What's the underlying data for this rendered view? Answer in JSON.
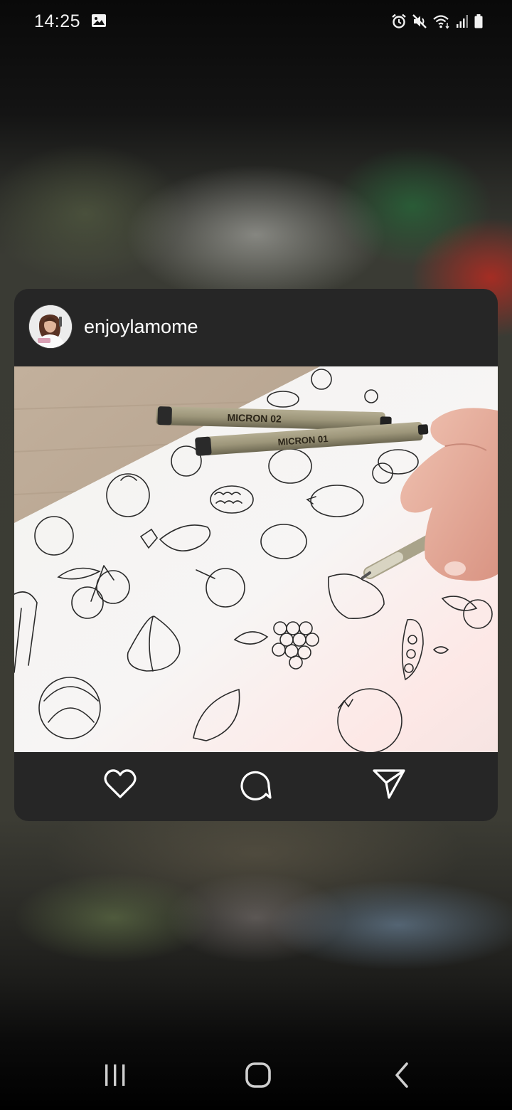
{
  "status_bar": {
    "time": "14:25",
    "left_icons": [
      "gallery-icon"
    ],
    "right_icons": [
      "alarm-icon",
      "mute-icon",
      "wifi-icon",
      "signal-icon",
      "battery-icon"
    ]
  },
  "post": {
    "username": "enjoylamome",
    "avatar_icon": "profile-avatar",
    "image_icon": "fruit-drawings-photo",
    "actions": {
      "like_icon": "heart-icon",
      "comment_icon": "comment-icon",
      "share_icon": "send-icon"
    }
  },
  "navigation_bar": {
    "icons": [
      "recent-apps-icon",
      "home-icon",
      "back-icon"
    ]
  },
  "colors": {
    "card_background": "#262626",
    "icon_color": "#ffffff",
    "nav_icon_color": "#cfcfcf"
  }
}
